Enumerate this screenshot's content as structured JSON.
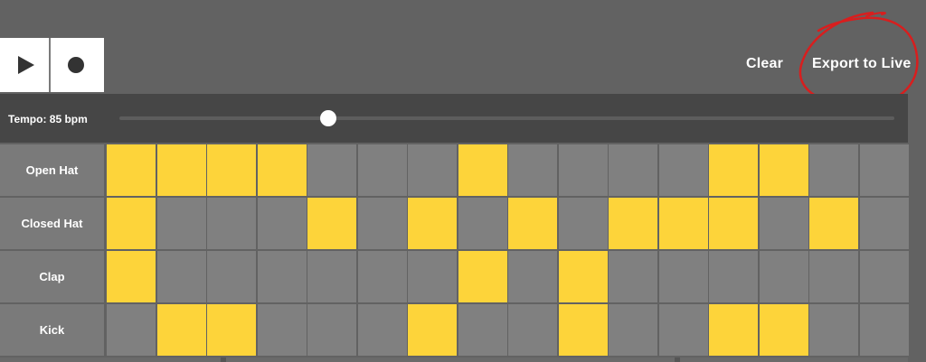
{
  "transport": {
    "play_icon": "play-icon",
    "record_icon": "record-icon"
  },
  "header": {
    "clear_label": "Clear",
    "export_label": "Export to Live",
    "annotation_color": "#d81e1e"
  },
  "tempo": {
    "label": "Tempo: 85 bpm",
    "bpm": 85,
    "slider_fraction": 0.27
  },
  "colors": {
    "active_step": "#fdd43a",
    "inactive_step": "#808080",
    "background": "#626262"
  },
  "tracks": [
    {
      "name": "Open Hat",
      "steps": [
        1,
        1,
        1,
        1,
        0,
        0,
        0,
        1,
        0,
        0,
        0,
        0,
        1,
        1,
        0,
        0
      ]
    },
    {
      "name": "Closed Hat",
      "steps": [
        1,
        0,
        0,
        0,
        1,
        0,
        1,
        0,
        1,
        0,
        1,
        1,
        1,
        0,
        1,
        0
      ]
    },
    {
      "name": "Clap",
      "steps": [
        1,
        0,
        0,
        0,
        0,
        0,
        0,
        1,
        0,
        1,
        0,
        0,
        0,
        0,
        0,
        0
      ]
    },
    {
      "name": "Kick",
      "steps": [
        0,
        1,
        1,
        0,
        0,
        0,
        1,
        0,
        0,
        1,
        0,
        0,
        1,
        1,
        0,
        0
      ]
    }
  ]
}
